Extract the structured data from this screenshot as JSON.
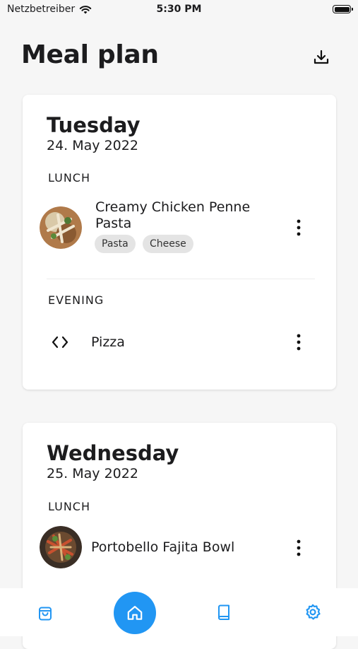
{
  "status_bar": {
    "carrier": "Netzbetreiber",
    "time": "5:30 PM"
  },
  "header": {
    "title": "Meal plan",
    "download_icon": "download-icon"
  },
  "days": [
    {
      "name": "Tuesday",
      "date": "24. May 2022",
      "slots": [
        {
          "label": "LUNCH",
          "meal": "Creamy Chicken Penne Pasta",
          "tags": [
            "Pasta",
            "Cheese"
          ]
        },
        {
          "label": "EVENING",
          "meal": "Pizza",
          "tags": []
        }
      ]
    },
    {
      "name": "Wednesday",
      "date": "25. May 2022",
      "slots": [
        {
          "label": "LUNCH",
          "meal": "Portobello Fajita Bowl",
          "tags": []
        }
      ]
    }
  ],
  "nav": {
    "items": [
      "shopping-bag-icon",
      "home-icon",
      "book-icon",
      "settings-icon"
    ],
    "active": "home-icon"
  },
  "colors": {
    "accent": "#2196f3",
    "background": "#f6f6f6",
    "card": "#ffffff",
    "tag_bg": "#e4e4e4"
  }
}
